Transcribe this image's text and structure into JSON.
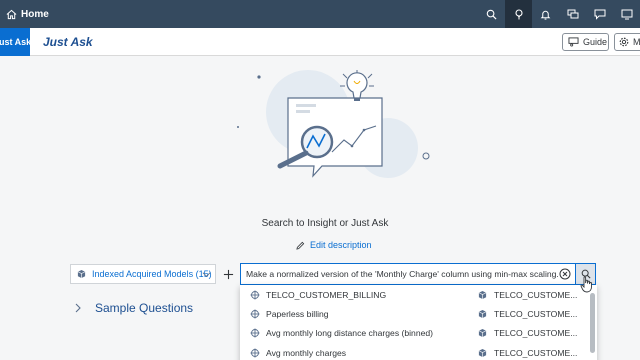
{
  "shell": {
    "home_label": "Home",
    "icons": [
      "search-icon",
      "insight-icon",
      "bell-icon",
      "chat-icon",
      "feedback-icon",
      "help-icon"
    ]
  },
  "subheader": {
    "tab_label": "Just Ask",
    "title": "Just Ask",
    "guide_label": "Guide",
    "more_label": "M"
  },
  "main": {
    "search_title": "Search to Insight or Just Ask",
    "edit_description": "Edit description",
    "model_select": "Indexed Acquired Models (15)",
    "search_value": "Make a normalized version of the 'Monthly Charge' column using min-max scaling.",
    "sample_questions": "Sample Questions"
  },
  "suggestions": [
    {
      "label": "TELCO_CUSTOMER_BILLING",
      "source": "TELCO_CUSTOME..."
    },
    {
      "label": "Paperless billing",
      "source": "TELCO_CUSTOME..."
    },
    {
      "label": "Avg monthly long distance charges (binned)",
      "source": "TELCO_CUSTOME..."
    },
    {
      "label": "Avg monthly charges",
      "source": "TELCO_CUSTOME..."
    }
  ],
  "colors": {
    "shell_bg": "#354a5f",
    "accent": "#0a6ed1",
    "title_blue": "#1d4f91"
  }
}
